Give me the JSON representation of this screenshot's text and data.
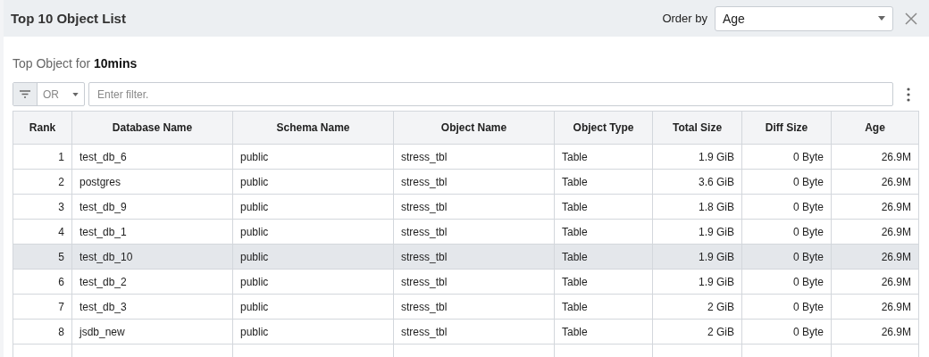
{
  "dialog": {
    "title": "Top 10 Object List",
    "order_by": {
      "label": "Order by",
      "value": "Age"
    }
  },
  "subtitle": "Top Object for **10mins**",
  "filter": {
    "operator": "OR",
    "placeholder": "Enter filter."
  },
  "table": {
    "columns": [
      "Rank",
      "Database Name",
      "Schema Name",
      "Object Name",
      "Object Type",
      "Total Size",
      "Diff Size",
      "Age"
    ],
    "rows": [
      {
        "selected": false,
        "cells": [
          "1",
          "test_db_6",
          "public",
          "stress_tbl",
          "Table",
          "1.9 GiB",
          "0 Byte",
          "26.9M"
        ]
      },
      {
        "selected": false,
        "cells": [
          "2",
          "postgres",
          "public",
          "stress_tbl",
          "Table",
          "3.6 GiB",
          "0 Byte",
          "26.9M"
        ]
      },
      {
        "selected": false,
        "cells": [
          "3",
          "test_db_9",
          "public",
          "stress_tbl",
          "Table",
          "1.8 GiB",
          "0 Byte",
          "26.9M"
        ]
      },
      {
        "selected": false,
        "cells": [
          "4",
          "test_db_1",
          "public",
          "stress_tbl",
          "Table",
          "1.9 GiB",
          "0 Byte",
          "26.9M"
        ]
      },
      {
        "selected": true,
        "cells": [
          "5",
          "test_db_10",
          "public",
          "stress_tbl",
          "Table",
          "1.9 GiB",
          "0 Byte",
          "26.9M"
        ]
      },
      {
        "selected": false,
        "cells": [
          "6",
          "test_db_2",
          "public",
          "stress_tbl",
          "Table",
          "1.9 GiB",
          "0 Byte",
          "26.9M"
        ]
      },
      {
        "selected": false,
        "cells": [
          "7",
          "test_db_3",
          "public",
          "stress_tbl",
          "Table",
          "2 GiB",
          "0 Byte",
          "26.9M"
        ]
      },
      {
        "selected": false,
        "cells": [
          "8",
          "jsdb_new",
          "public",
          "stress_tbl",
          "Table",
          "2 GiB",
          "0 Byte",
          "26.9M"
        ]
      }
    ]
  }
}
